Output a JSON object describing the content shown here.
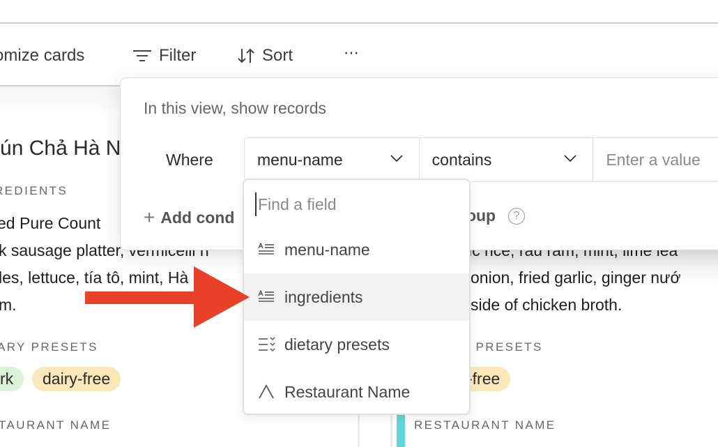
{
  "toolbar": {
    "customize_label": "Customize cards",
    "customize_visible": "omize cards",
    "filter_label": "Filter",
    "sort_label": "Sort",
    "more_label": "⋯",
    "filter_icon": "filter-lines-icon",
    "sort_icon": "sort-arrows-icon",
    "more_icon": "more-horizontal-icon"
  },
  "cards": [
    {
      "title_visible": "Bún Chả Hà Nội",
      "fields": {
        "ingredients_label": "Ingredients",
        "ingredients_visible": "REDIENTS",
        "ingredients_lines": [
          "ed Pure Count",
          "k sausage platter, vermicelli n",
          "les, lettuce, tía tô, mint, Hà N",
          "m."
        ],
        "dietary_label_visible": "ARY PRESETS",
        "dietary_tags": [
          {
            "label": "rk",
            "color": "#d8f3d8"
          },
          {
            "label": "dairy-free",
            "color": "#fbe8b9"
          }
        ],
        "restaurant_label_visible": "TAURANT NAME"
      }
    },
    {
      "fields": {
        "ingredients_lines": [
          "ic rice, rau răm, mint, lime lea",
          "onion, fried garlic, ginger nướ",
          "side of chicken broth."
        ],
        "dietary_label_visible": "Y PRESETS",
        "dietary_tags": [
          {
            "label": "-free",
            "color": "#fbe8b9"
          }
        ],
        "restaurant_label": "RESTAURANT NAME",
        "accent_color": "#62d8d0"
      }
    }
  ],
  "filter_popover": {
    "heading": "In this view, show records",
    "where_label": "Where",
    "condition": {
      "field": "menu-name",
      "operator": "contains",
      "value": "",
      "value_placeholder": "Enter a value"
    },
    "add_condition_label": "Add condition",
    "add_condition_visible": "Add cond",
    "add_group_visible": "roup",
    "add_group_label": "Add condition group"
  },
  "field_dropdown": {
    "search_placeholder": "Find a field",
    "items": [
      {
        "label": "menu-name",
        "icon": "long-text-icon"
      },
      {
        "label": "ingredients",
        "icon": "long-text-icon",
        "highlighted": true
      },
      {
        "label": "dietary presets",
        "icon": "multi-select-icon"
      },
      {
        "label": "Restaurant Name",
        "icon": "single-line-text-icon"
      }
    ]
  },
  "annotation": {
    "arrow_color": "#e84127",
    "points_to": "ingredients"
  }
}
